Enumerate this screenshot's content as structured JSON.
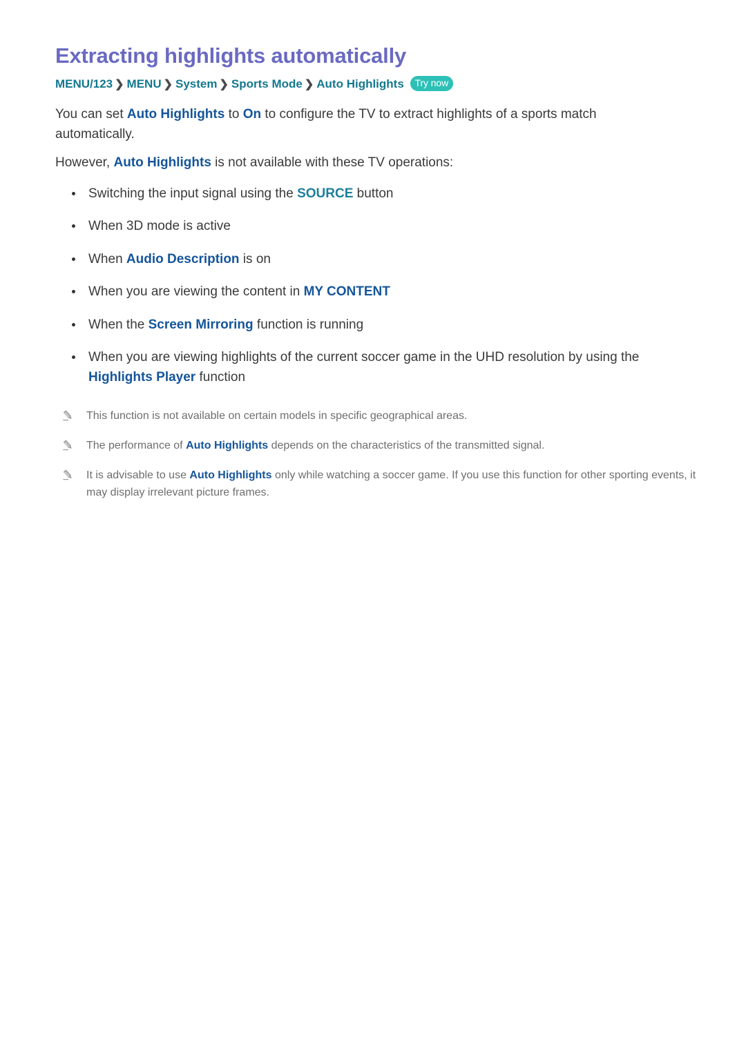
{
  "document": {
    "title": "Extracting highlights automatically"
  },
  "breadcrumb": {
    "items": [
      "MENU/123",
      "MENU",
      "System",
      "Sports Mode",
      "Auto Highlights"
    ],
    "separator": "❯",
    "badge": "Try now"
  },
  "paragraphs": [
    {
      "segments": [
        {
          "text": "You can set ",
          "style": "plain"
        },
        {
          "text": "Auto Highlights",
          "style": "blue"
        },
        {
          "text": " to ",
          "style": "plain"
        },
        {
          "text": "On",
          "style": "blue"
        },
        {
          "text": " to configure the TV to extract highlights of a sports match automatically.",
          "style": "plain"
        }
      ]
    },
    {
      "segments": [
        {
          "text": "However, ",
          "style": "plain"
        },
        {
          "text": "Auto Highlights",
          "style": "blue"
        },
        {
          "text": " is not available with these TV operations:",
          "style": "plain"
        }
      ]
    }
  ],
  "bullets": [
    {
      "segments": [
        {
          "text": "Switching the input signal using the ",
          "style": "plain"
        },
        {
          "text": "SOURCE",
          "style": "teal"
        },
        {
          "text": " button",
          "style": "plain"
        }
      ]
    },
    {
      "segments": [
        {
          "text": "When 3D mode is active",
          "style": "plain"
        }
      ]
    },
    {
      "segments": [
        {
          "text": "When ",
          "style": "plain"
        },
        {
          "text": "Audio Description",
          "style": "blue"
        },
        {
          "text": " is on",
          "style": "plain"
        }
      ]
    },
    {
      "segments": [
        {
          "text": "When you are viewing the content in ",
          "style": "plain"
        },
        {
          "text": "MY CONTENT",
          "style": "blue"
        }
      ]
    },
    {
      "segments": [
        {
          "text": "When the ",
          "style": "plain"
        },
        {
          "text": "Screen Mirroring",
          "style": "blue"
        },
        {
          "text": " function is running",
          "style": "plain"
        }
      ]
    },
    {
      "segments": [
        {
          "text": "When you are viewing highlights of the current soccer game in the UHD resolution by using the ",
          "style": "plain"
        },
        {
          "text": "Highlights Player",
          "style": "blue"
        },
        {
          "text": " function",
          "style": "plain"
        }
      ]
    }
  ],
  "notes": [
    {
      "icon": "pencil-icon",
      "segments": [
        {
          "text": "This function is not available on certain models in specific geographical areas.",
          "style": "plain"
        }
      ]
    },
    {
      "icon": "pencil-icon",
      "segments": [
        {
          "text": "The performance of ",
          "style": "plain"
        },
        {
          "text": "Auto Highlights",
          "style": "blue"
        },
        {
          "text": " depends on the characteristics of the transmitted signal.",
          "style": "plain"
        }
      ]
    },
    {
      "icon": "pencil-icon",
      "segments": [
        {
          "text": "It is advisable to use ",
          "style": "plain"
        },
        {
          "text": "Auto Highlights",
          "style": "blue"
        },
        {
          "text": " only while watching a soccer game. If you use this function for other sporting events, it may display irrelevant picture frames.",
          "style": "plain"
        }
      ]
    }
  ],
  "colors": {
    "title": "#6a6ac2",
    "breadcrumb": "#13788f",
    "badge_bg": "#2cc0b6",
    "keyword_blue": "#15559a",
    "keyword_teal": "#1b7f9e",
    "body_text": "#3a3a3a",
    "note_text": "#6e6e6e"
  }
}
